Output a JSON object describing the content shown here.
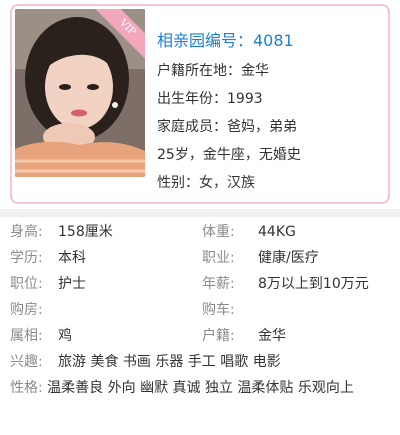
{
  "profile": {
    "vip_badge": "VIP",
    "id_line": "相亲园编号：4081",
    "hukou_line": "户籍所在地：金华",
    "birth_line": "出生年份：1993",
    "family_line": "家庭成员：爸妈，弟弟",
    "summary_line": "25岁，金牛座，无婚史",
    "gender_line": "性别：女，汉族"
  },
  "details": {
    "height": {
      "label": "身高:",
      "value": "158厘米"
    },
    "weight": {
      "label": "体重:",
      "value": "44KG"
    },
    "education": {
      "label": "学历:",
      "value": "本科"
    },
    "occupation": {
      "label": "职业:",
      "value": "健康/医疗"
    },
    "position": {
      "label": "职位:",
      "value": "护士"
    },
    "salary": {
      "label": "年薪:",
      "value": "8万以上到10万元"
    },
    "house": {
      "label": "购房:",
      "value": ""
    },
    "car": {
      "label": "购车:",
      "value": ""
    },
    "zodiac": {
      "label": "属相:",
      "value": "鸡"
    },
    "hukou": {
      "label": "户籍:",
      "value": "金华"
    },
    "hobbies": {
      "label": "兴趣:",
      "value": "旅游 美食 书画 乐器 手工 唱歌 电影"
    },
    "personality": {
      "label": "性格:",
      "value": "温柔善良 外向 幽默 真诚 独立 温柔体贴 乐观向上"
    }
  },
  "colors": {
    "id_blue": "#1e7ed8",
    "card_border": "#f6c6d2",
    "label_gray": "#8c8c8c"
  }
}
